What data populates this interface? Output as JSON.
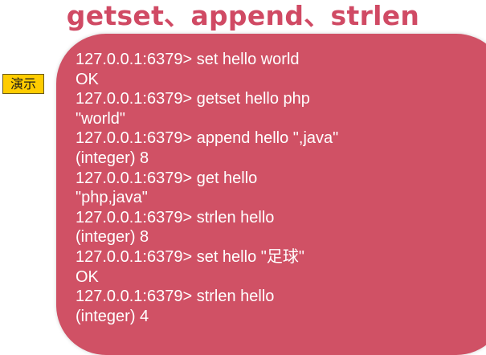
{
  "slide": {
    "title": "getset、append、strlen",
    "badge": "演示"
  },
  "colors": {
    "title": "#d04a64",
    "panel": "#d05165",
    "badge": "#ffcc00",
    "terminal_text": "#ffffff"
  },
  "terminal": {
    "lines": [
      "127.0.0.1:6379> set hello world",
      "OK",
      "127.0.0.1:6379> getset hello php",
      "\"world\"",
      "127.0.0.1:6379> append hello \",java\"",
      "(integer) 8",
      "127.0.0.1:6379> get hello",
      "\"php,java\"",
      "127.0.0.1:6379> strlen hello",
      "(integer) 8",
      "127.0.0.1:6379> set hello \"足球\"",
      "OK",
      "127.0.0.1:6379> strlen hello",
      "(integer) 4"
    ]
  }
}
